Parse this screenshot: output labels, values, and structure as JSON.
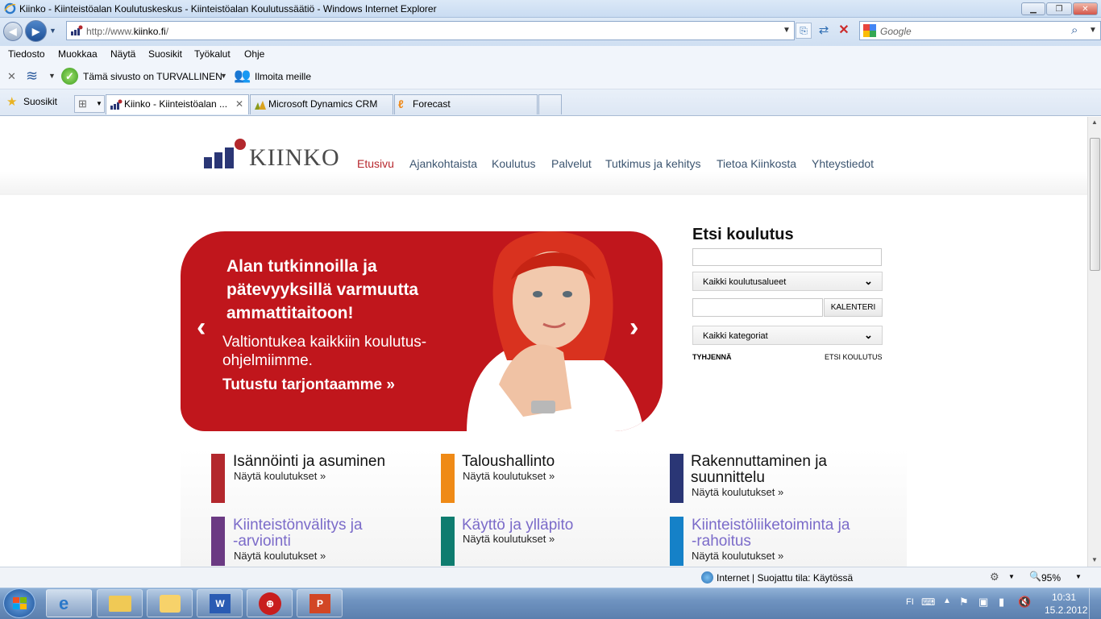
{
  "window": {
    "title": "Kiinko - Kiinteistöalan Koulutuskeskus - Kiinteistöalan Koulutussäätiö - Windows Internet Explorer"
  },
  "address_bar": {
    "url_prefix": "http://www.",
    "url_domain": "kiinko.fi",
    "url_suffix": "/"
  },
  "search_bar": {
    "placeholder": "Google"
  },
  "menu": [
    "Tiedosto",
    "Muokkaa",
    "Näytä",
    "Suosikit",
    "Työkalut",
    "Ohje"
  ],
  "toolbar": {
    "security_label": "Tämä sivusto on TURVALLINEN",
    "report_label": "Ilmoita meille"
  },
  "favorites": {
    "label": "Suosikit"
  },
  "tabs": [
    {
      "label": "Kiinko - Kiinteistöalan ..."
    },
    {
      "label": "Microsoft Dynamics CRM"
    },
    {
      "label": "Forecast"
    }
  ],
  "site": {
    "logo_text": "KIINKO",
    "nav": [
      "Etusivu",
      "Ajankohtaista",
      "Koulutus",
      "Palvelut",
      "Tutkimus ja kehitys",
      "Tietoa Kiinkosta",
      "Yhteystiedot"
    ],
    "banner": {
      "headline_1": "Alan tutkinnoilla ja",
      "headline_2": "pätevyyksillä varmuutta",
      "headline_3": "ammattitaitoon!",
      "sub_1": "Valtiontukea kaikkiin koulutus-",
      "sub_2": "ohjelmiimme.",
      "cta": "Tutustu tarjontaamme »",
      "prev": "‹",
      "next": "›"
    },
    "search": {
      "title": "Etsi koulutus",
      "select_area": "Kaikki koulutusalueet",
      "calendar_button": "KALENTERI",
      "select_category": "Kaikki kategoriat",
      "clear": "TYHJENNÄ",
      "submit": "ETSI KOULUTUS"
    },
    "categories": [
      {
        "title_1": "Isännöinti ja asuminen",
        "title_2": "",
        "link": "Näytä koulutukset »",
        "color": "#b3282d",
        "title_color": "#111111"
      },
      {
        "title_1": "Taloushallinto",
        "title_2": "",
        "link": "Näytä koulutukset »",
        "color": "#ef8a16",
        "title_color": "#111111"
      },
      {
        "title_1": "Rakennuttaminen ja",
        "title_2": "suunnittelu",
        "link": "Näytä koulutukset »",
        "color": "#2a3675",
        "title_color": "#111111"
      },
      {
        "title_1": "Kiinteistönvälitys ja",
        "title_2": "-arviointi",
        "link": "Näytä koulutukset »",
        "color": "#6b3a83",
        "title_color": "#7b6bc9"
      },
      {
        "title_1": "Käyttö ja ylläpito",
        "title_2": "",
        "link": "Näytä koulutukset »",
        "color": "#0e7c6f",
        "title_color": "#7b6bc9"
      },
      {
        "title_1": "Kiinteistöliiketoiminta ja",
        "title_2": "-rahoitus",
        "link": "Näytä koulutukset »",
        "color": "#1581c8",
        "title_color": "#7b6bc9"
      }
    ]
  },
  "status_bar": {
    "zone": "Internet | Suojattu tila: Käytössä",
    "zoom": "95%"
  },
  "taskbar": {
    "lang": "FI",
    "time": "10:31",
    "date": "15.2.2012"
  }
}
